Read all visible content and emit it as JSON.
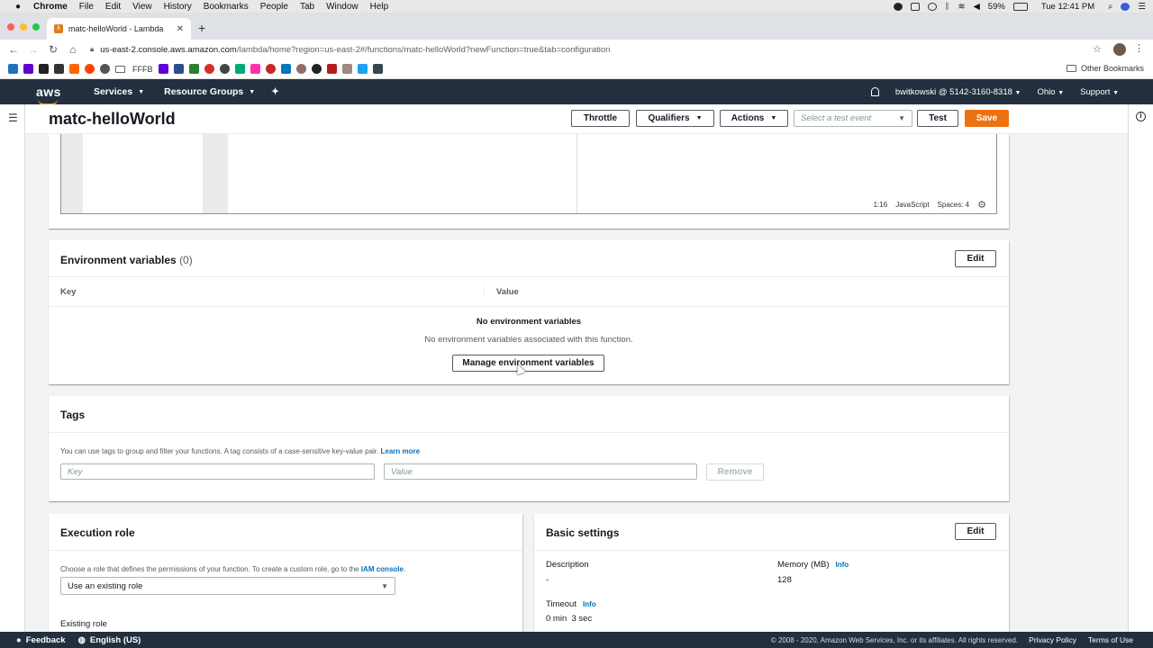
{
  "mac_menu": {
    "app": "Chrome",
    "items": [
      "File",
      "Edit",
      "View",
      "History",
      "Bookmarks",
      "People",
      "Tab",
      "Window",
      "Help"
    ],
    "battery": "59%",
    "clock": "Tue 12:41 PM"
  },
  "browser": {
    "tab_title": "matc-helloWorld - Lambda",
    "url_host": "us-east-2.console.aws.amazon.com",
    "url_path": "/lambda/home?region=us-east-2#/functions/matc-helloWorld?newFunction=true&tab=configuration",
    "bookmark_text": "FFFB",
    "other_bookmarks": "Other Bookmarks"
  },
  "aws_header": {
    "logo": "aws",
    "services": "Services",
    "resource_groups": "Resource Groups",
    "account": "bwitkowski @ 5142-3160-8318",
    "region": "Ohio",
    "support": "Support"
  },
  "function_header": {
    "title": "matc-helloWorld",
    "throttle": "Throttle",
    "qualifiers": "Qualifiers",
    "actions": "Actions",
    "test_event_placeholder": "Select a test event",
    "test": "Test",
    "save": "Save"
  },
  "editor": {
    "position": "1:16",
    "language": "JavaScript",
    "spaces": "Spaces: 4"
  },
  "env_vars": {
    "title": "Environment variables",
    "count": "(0)",
    "edit": "Edit",
    "col_key": "Key",
    "col_value": "Value",
    "empty_title": "No environment variables",
    "empty_desc": "No environment variables associated with this function.",
    "manage_button": "Manage environment variables"
  },
  "tags": {
    "title": "Tags",
    "description": "You can use tags to group and filter your functions. A tag consists of a case-sensitive key-value pair.",
    "learn_more": "Learn more",
    "key_placeholder": "Key",
    "value_placeholder": "Value",
    "remove": "Remove"
  },
  "execution_role": {
    "title": "Execution role",
    "description": "Choose a role that defines the permissions of your function. To create a custom role, go to the",
    "iam_link": "IAM console",
    "period": ".",
    "role_select": "Use an existing role",
    "existing_role_label": "Existing role"
  },
  "basic_settings": {
    "title": "Basic settings",
    "edit": "Edit",
    "description_label": "Description",
    "description_value": "-",
    "memory_label": "Memory (MB)",
    "memory_value": "128",
    "timeout_label": "Timeout",
    "timeout_value": "0 min  3 sec",
    "info": "Info"
  },
  "footer": {
    "feedback": "Feedback",
    "language": "English (US)",
    "copyright": "© 2008 - 2020, Amazon Web Services, Inc. or its affiliates. All rights reserved.",
    "privacy": "Privacy Policy",
    "terms": "Terms of Use"
  }
}
